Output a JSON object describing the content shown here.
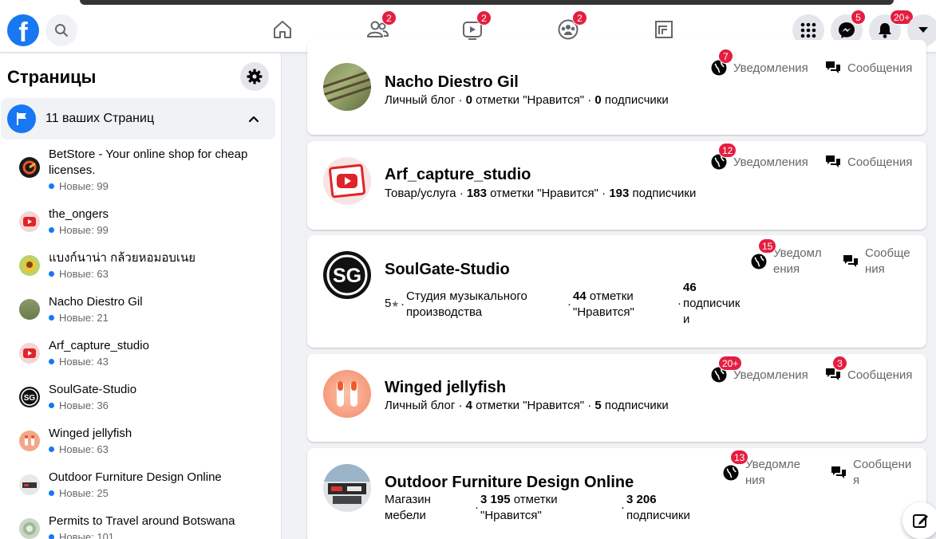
{
  "topbar": {
    "badges": {
      "friends": "2",
      "watch": "2",
      "groups": "2",
      "messenger": "5",
      "notifications": "20+"
    }
  },
  "sidebar": {
    "title": "Страницы",
    "section_label": "11 ваших Страниц",
    "new_prefix": "Новые:",
    "items": [
      {
        "name": "BetStore - Your online shop for cheap licenses.",
        "new_count": "99"
      },
      {
        "name": "the_ongers",
        "new_count": "99"
      },
      {
        "name": "แบงก์นาน่า กล้วยหอมอบเนย",
        "new_count": "63"
      },
      {
        "name": "Nacho Diestro Gil",
        "new_count": "21"
      },
      {
        "name": "Arf_capture_studio",
        "new_count": "43"
      },
      {
        "name": "SoulGate-Studio",
        "new_count": "36"
      },
      {
        "name": "Winged jellyfish",
        "new_count": "63"
      },
      {
        "name": "Outdoor Furniture Design Online",
        "new_count": "25"
      },
      {
        "name": "Permits to Travel around Botswana",
        "new_count": "101"
      }
    ]
  },
  "labels": {
    "notifications": "Уведомления",
    "messages": "Сообщения",
    "notifications_wrap1": "Уведомле",
    "notifications_wrap2": "ния",
    "messages_wrap1": "Сообщени",
    "messages_wrap2": "я",
    "notifications_wrap_b1": "Уведомл",
    "notifications_wrap_b2": "ения",
    "messages_wrap_b1": "Сообще",
    "messages_wrap_b2": "ния",
    "likes": "отметки \"Нравится\"",
    "likes_wrap1": "отметки",
    "likes_wrap2": "\"Нравится\"",
    "followers": "подписчики",
    "followers_wrap1": "подписчик",
    "followers_wrap2": "и"
  },
  "cards": [
    {
      "name": "Nacho Diestro Gil",
      "category": "Личный блог",
      "likes": "0",
      "followers": "0",
      "notif_badge": "7"
    },
    {
      "name": "Arf_capture_studio",
      "category": "Товар/услуга",
      "likes": "183",
      "followers": "193",
      "notif_badge": "12"
    },
    {
      "name": "SoulGate-Studio",
      "rating": "5",
      "category_line1": "Студия музыкального",
      "category_line2": "производства",
      "likes": "44",
      "followers": "46",
      "notif_badge": "15"
    },
    {
      "name": "Winged jellyfish",
      "category": "Личный блог",
      "likes": "4",
      "followers": "5",
      "notif_badge": "20+",
      "msg_badge": "3"
    },
    {
      "name": "Outdoor Furniture Design Online",
      "category_line1": "Магазин",
      "category_line2": "мебели",
      "likes": "3 195",
      "followers": "3 206",
      "notif_badge": "13"
    }
  ],
  "colors": {
    "brand": "#1877f2",
    "badge": "#e41e3f",
    "secondary_text": "#65676b"
  }
}
